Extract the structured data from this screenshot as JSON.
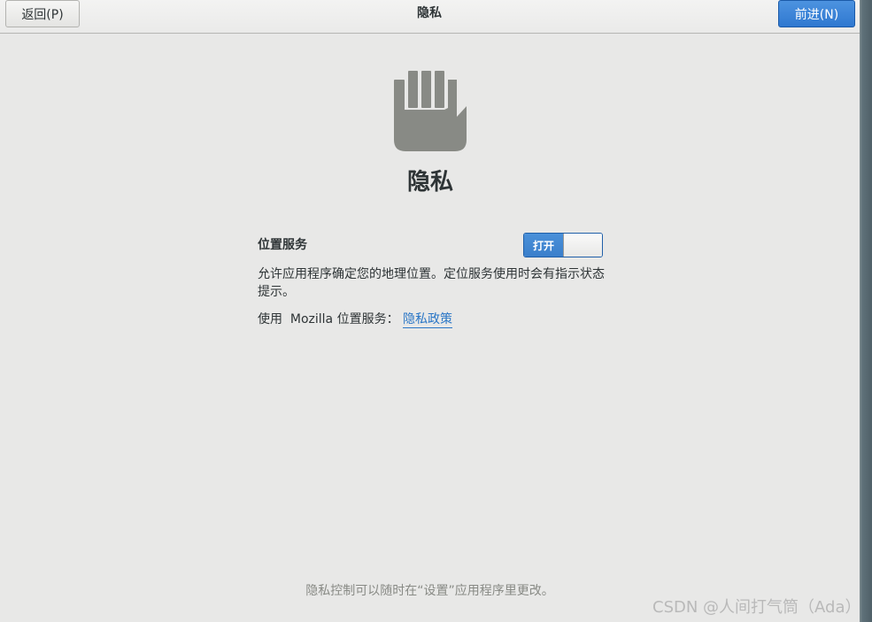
{
  "header": {
    "back_label": "返回(P)",
    "title": "隐私",
    "next_label": "前进(N)"
  },
  "main": {
    "icon": "privacy-hand-icon",
    "title": "隐私",
    "location_services": {
      "label": "位置服务",
      "toggle_state": "打开",
      "enabled": true
    },
    "description": "允许应用程序确定您的地理位置。定位服务使用时会有指示状态提示。",
    "mozilla_text": "使用  Mozilla 位置服务： ",
    "privacy_policy_link": "隐私政策",
    "footer_note": "隐私控制可以随时在“设置”应用程序里更改。"
  },
  "watermark": "CSDN @人间打气筒（Ada）",
  "colors": {
    "accent": "#3a7fcb",
    "link": "#2a76c6",
    "icon_gray": "#888a85"
  }
}
